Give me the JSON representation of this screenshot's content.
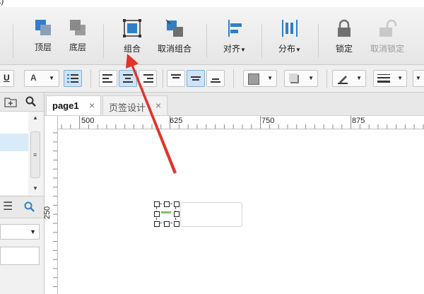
{
  "window": {
    "title_fragment": "t)"
  },
  "ribbon": {
    "bring_front": "顶层",
    "send_back": "底层",
    "group": "组合",
    "ungroup": "取消组合",
    "align": "对齐",
    "distribute": "分布",
    "lock": "锁定",
    "unlock": "取消锁定"
  },
  "toolbar": {
    "font_color_letter": "A"
  },
  "tabs": [
    {
      "label": "page1",
      "close": "×"
    },
    {
      "label": "页签设计",
      "close": "×"
    }
  ],
  "ruler": {
    "h_ticks": [
      "500",
      "625",
      "750",
      "875"
    ],
    "v_ticks": [
      "250"
    ]
  },
  "colors": {
    "accent_blue": "#2f7fc8",
    "arrow_red": "#e0342c",
    "selection_green": "#7ac46a"
  }
}
